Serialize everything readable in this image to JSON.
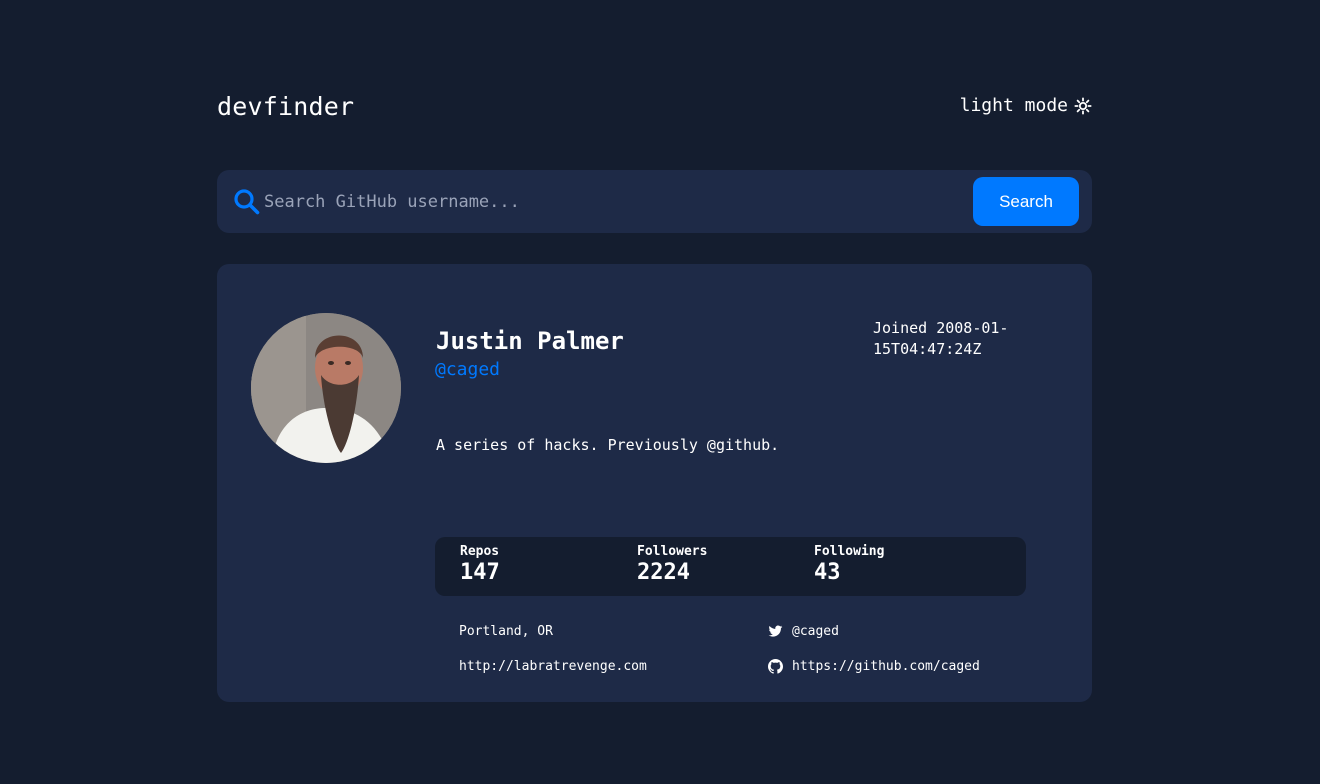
{
  "header": {
    "logo": "devfinder",
    "mode_label": "light mode",
    "mode_icon": "sun-icon"
  },
  "search": {
    "placeholder": "Search GitHub username...",
    "value": "",
    "button_label": "Search",
    "icon": "search-icon"
  },
  "profile": {
    "name": "Justin Palmer",
    "login": "@caged",
    "joined": "Joined 2008-01-15T04:47:24Z",
    "bio": "A series of hacks. Previously @github.",
    "avatar": "avatar-photo"
  },
  "stats": [
    {
      "label": "Repos",
      "value": "147"
    },
    {
      "label": "Followers",
      "value": "2224"
    },
    {
      "label": "Following",
      "value": "43"
    }
  ],
  "links": {
    "location": "Portland, OR",
    "twitter": "@caged",
    "blog": "http://labratrevenge.com",
    "github": "https://github.com/caged"
  },
  "colors": {
    "background": "#141d2f",
    "card": "#1e2a47",
    "accent": "#0079ff",
    "text": "#ffffff"
  }
}
